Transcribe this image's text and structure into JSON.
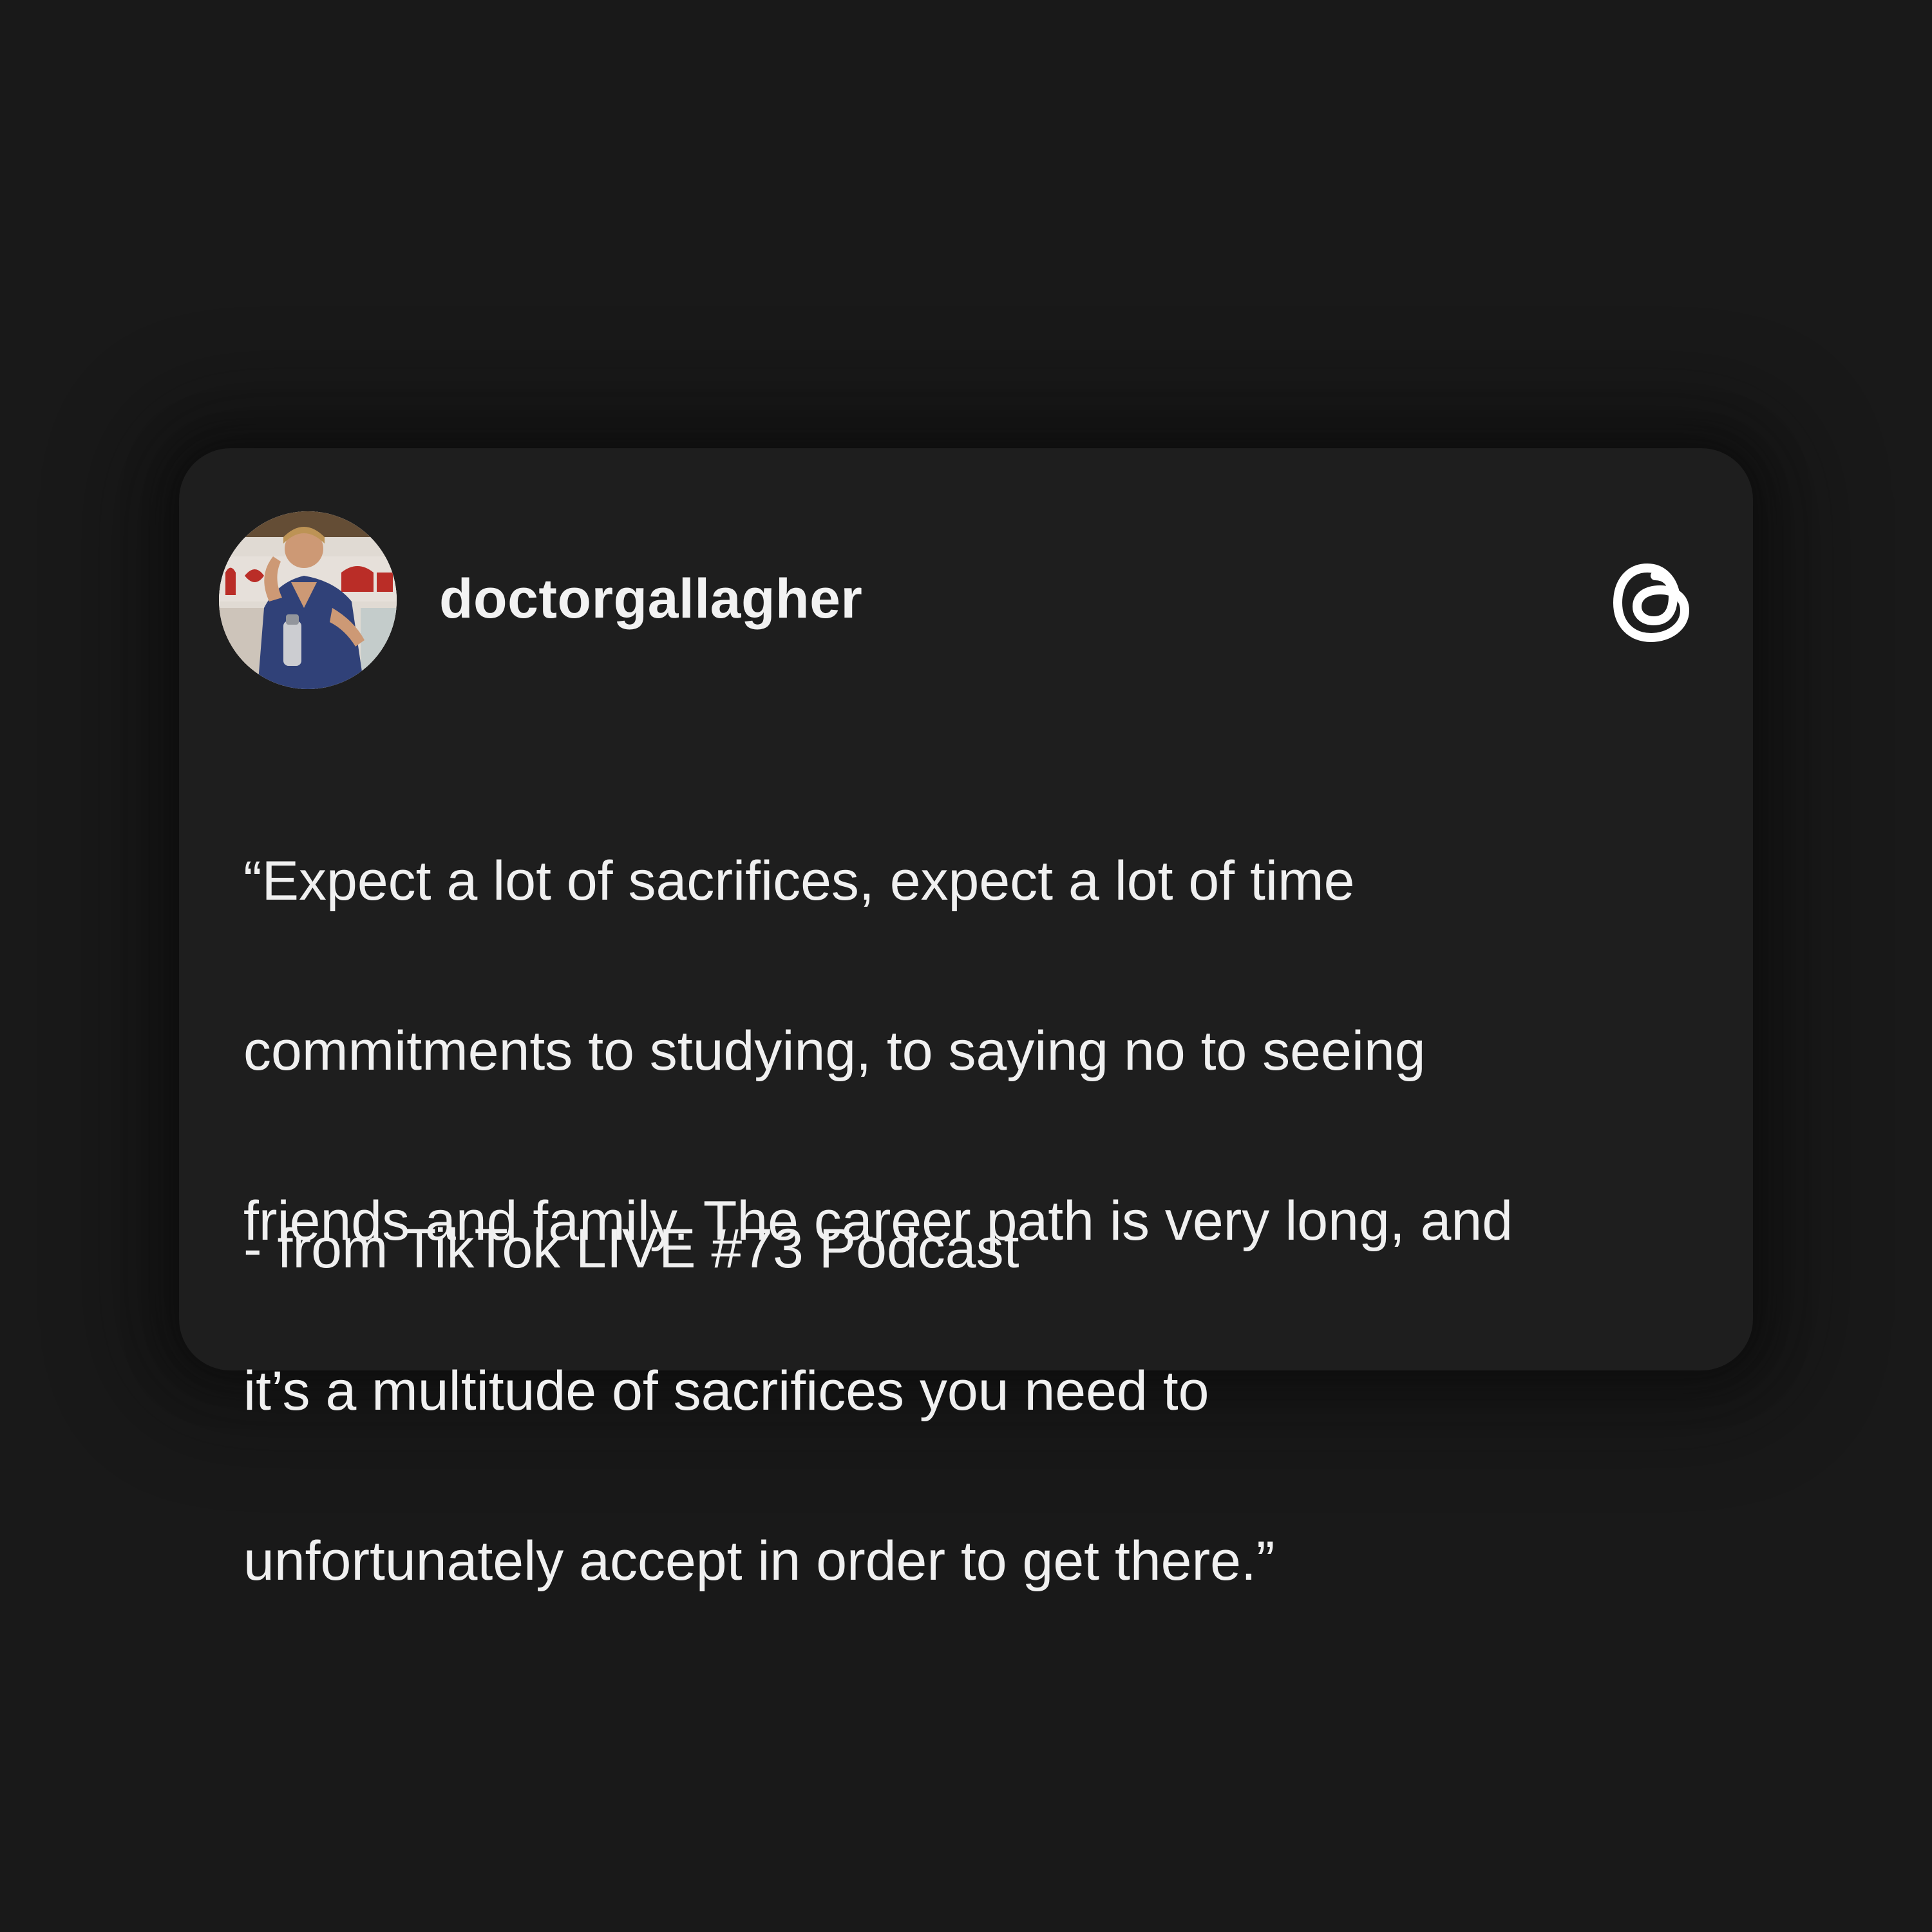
{
  "post": {
    "username": "doctorgallagher",
    "avatar_alt": "profile-photo",
    "quote_lines": [
      "“Expect a lot of sacrifices, expect a lot of time",
      "commitments to studying, to saying no to seeing",
      "friends and family. The career path is very long, and",
      "it’s a multitude of sacrifices you need to",
      "unfortunately accept in order to get there.”"
    ],
    "source": "- from TikTok LIVE #73 Podcast",
    "brand_icon": "threads-logo-icon"
  },
  "colors": {
    "background": "#191919",
    "card": "#1e1e1e",
    "text": "#f0f0f0"
  }
}
